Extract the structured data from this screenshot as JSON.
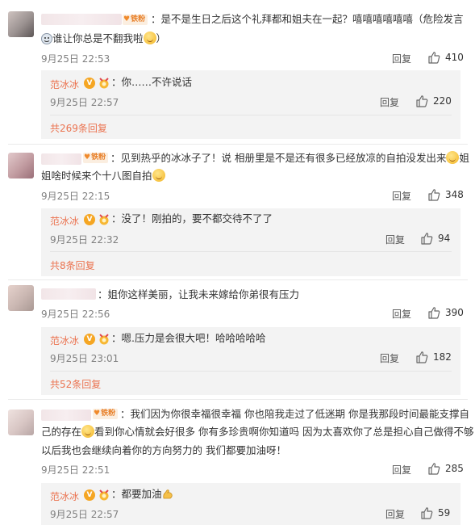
{
  "comments": [
    {
      "text_line1": "：是不是生日之后这个礼拜都和姐夫在一起？嘻嘻嘻嘻嘻嘻（危险发言",
      "text_line2": "谁让你总是不翻我啦",
      "text_line2_end": "）",
      "date": "9月25日 22:53",
      "reply_label": "回复",
      "likes": "410",
      "fan_badge": "铁粉",
      "reply": {
        "name": "范冰冰",
        "text": "：你……不许说话",
        "date": "9月25日 22:57",
        "reply_label": "回复",
        "likes": "220"
      },
      "more": "共269条回复"
    },
    {
      "text_line1": "：见到热乎的冰冰子了！说 相册里是不是还有很多已经放凉的自拍没发出来",
      "text_line1_end": "姐",
      "text_line2": "姐啥时候来个十八图自拍",
      "date": "9月25日 22:15",
      "reply_label": "回复",
      "likes": "348",
      "fan_badge": "铁粉",
      "reply": {
        "name": "范冰冰",
        "text": "：没了！刚拍的，要不都交待不了了",
        "date": "9月25日 22:32",
        "reply_label": "回复",
        "likes": "94"
      },
      "more": "共8条回复"
    },
    {
      "text_line1": "：姐你这样美丽，让我未来嫁给你弟很有压力",
      "date": "9月25日 22:56",
      "reply_label": "回复",
      "likes": "390",
      "reply": {
        "name": "范冰冰",
        "text": "：嗯.压力是会很大吧！哈哈哈哈哈",
        "date": "9月25日 23:01",
        "reply_label": "回复",
        "likes": "182"
      },
      "more": "共52条回复"
    },
    {
      "text_line1": "：我们因为你很幸福很幸福 你也陪我走过了低迷期 你是我那段时间最能支撑自",
      "text_line2": "己的存在",
      "text_line2b": "看到你心情就会好很多 你有多珍贵啊你知道吗 因为太喜欢你了总是担心自己做得不够",
      "text_line3": "以后我也会继续向着你的方向努力的 我们都要加油呀！",
      "date": "9月25日 22:51",
      "reply_label": "回复",
      "likes": "285",
      "fan_badge": "铁粉",
      "reply": {
        "name": "范冰冰",
        "text": "：都要加油",
        "date": "9月25日 22:57",
        "reply_label": "回复",
        "likes": "59"
      }
    }
  ],
  "colors": {
    "name": "#eb7350",
    "meta": "#808080",
    "reply_bg": "#f3f3f3"
  }
}
